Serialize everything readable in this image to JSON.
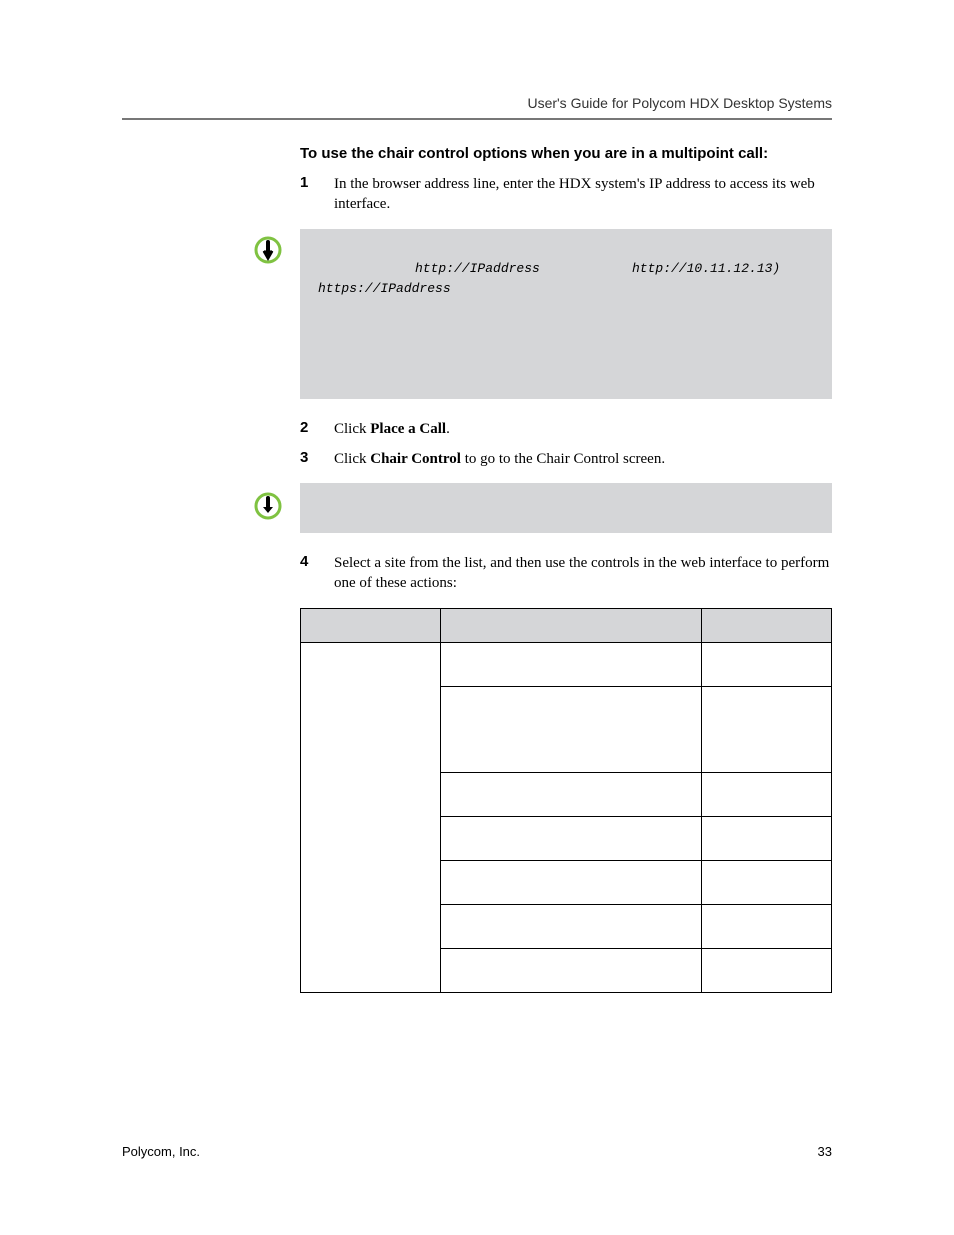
{
  "header": {
    "title": "User's Guide for Polycom HDX Desktop Systems"
  },
  "section": {
    "heading": "To use the chair control options when you are in a multipoint call:"
  },
  "steps": {
    "s1": {
      "num": "1",
      "text": "In the browser address line, enter the HDX system's IP address to access its web interface."
    },
    "s2": {
      "num": "2",
      "pre": "Click ",
      "bold": "Place a Call",
      "post": "."
    },
    "s3": {
      "num": "3",
      "pre": "Click ",
      "bold": "Chair Control",
      "post": " to go to the Chair Control screen."
    },
    "s4": {
      "num": "4",
      "text": "Select a site from the list, and then use the controls in the web interface to perform one of these actions:"
    }
  },
  "note1": {
    "code1": "http://IPaddress",
    "code2": "http://10.11.12.13)",
    "code3": "https://IPaddress"
  },
  "table": {
    "headers": {
      "c1": "",
      "c2": "",
      "c3": ""
    },
    "rows": [
      {
        "c1": "",
        "c2": "",
        "c3": "",
        "span": 7,
        "tall": false
      },
      {
        "c2": "",
        "c3": "",
        "tall": true
      },
      {
        "c2": "",
        "c3": ""
      },
      {
        "c2": "",
        "c3": ""
      },
      {
        "c2": "",
        "c3": ""
      },
      {
        "c2": "",
        "c3": ""
      },
      {
        "c2": "",
        "c3": ""
      }
    ]
  },
  "footer": {
    "left": "Polycom, Inc.",
    "right": "33"
  }
}
